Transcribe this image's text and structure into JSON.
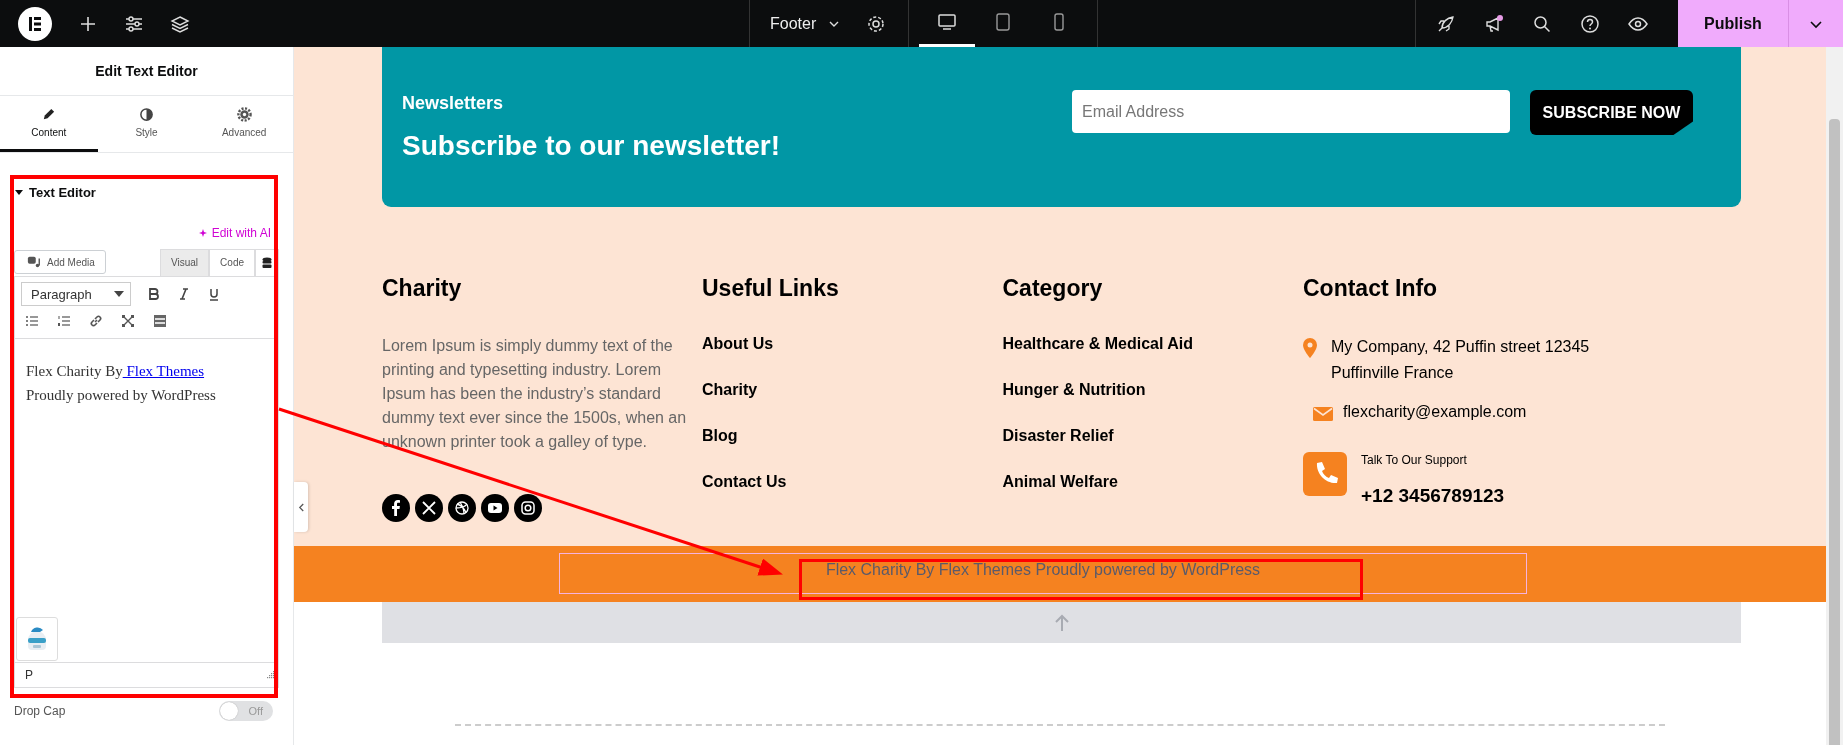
{
  "topbar": {
    "page_selector": "Footer",
    "devices": [
      {
        "kind": "desktop",
        "selected": true
      },
      {
        "kind": "tablet",
        "selected": false
      },
      {
        "kind": "mobile",
        "selected": false
      }
    ],
    "publish": "Publish"
  },
  "panel": {
    "title": "Edit Text Editor",
    "tabs": [
      {
        "kind": "content",
        "label": "Content",
        "selected": true
      },
      {
        "kind": "style",
        "label": "Style",
        "selected": false
      },
      {
        "kind": "advanced",
        "label": "Advanced",
        "selected": false
      }
    ],
    "section": {
      "title": "Text Editor",
      "expanded": true,
      "ai_link": "Edit with AI",
      "add_media": "Add Media",
      "editor_tabs": [
        {
          "label": "Visual",
          "selected": true
        },
        {
          "label": "Code",
          "selected": false
        }
      ],
      "format_select": "Paragraph",
      "content_text": "Flex Charity By",
      "content_link": " Flex Themes",
      "content_line_2": "Proudly powered by WordPress",
      "path": "P"
    },
    "drop_cap": {
      "label": "Drop Cap",
      "on": false,
      "state_label": "Off"
    }
  },
  "newsletter": {
    "eyebrow": "Newsletters",
    "heading": "Subscribe to our newsletter!",
    "email_placeholder": "Email Address",
    "button": "SUBSCRIBE NOW"
  },
  "footer": {
    "about": {
      "title": "Charity",
      "text": "Lorem Ipsum is simply dummy text of the printing and typesetting industry. Lorem Ipsum has been the industry’s standard dummy text ever since the 1500s, when an unknown printer took a galley of type.",
      "socials": [
        {
          "kind": "facebook"
        },
        {
          "kind": "x"
        },
        {
          "kind": "dribbble"
        },
        {
          "kind": "youtube"
        },
        {
          "kind": "instagram"
        }
      ]
    },
    "useful_links": {
      "title": "Useful Links",
      "items": [
        "About Us",
        "Charity",
        "Blog",
        "Contact Us"
      ]
    },
    "category": {
      "title": "Category",
      "items": [
        "Healthcare & Medical Aid",
        "Hunger & Nutrition",
        "Disaster Relief",
        "Animal Welfare"
      ]
    },
    "contact": {
      "title": "Contact Info",
      "items": [
        {
          "kind": "address",
          "text": "My Company, 42 Puffin street 12345 Puffinville France"
        },
        {
          "kind": "email",
          "text": "flexcharity@example.com"
        },
        {
          "kind": "phone",
          "label": "Talk To Our Support",
          "text": "+12 3456789123"
        }
      ]
    }
  },
  "copyright": "Flex Charity By Flex Themes Proudly powered by WordPress"
}
